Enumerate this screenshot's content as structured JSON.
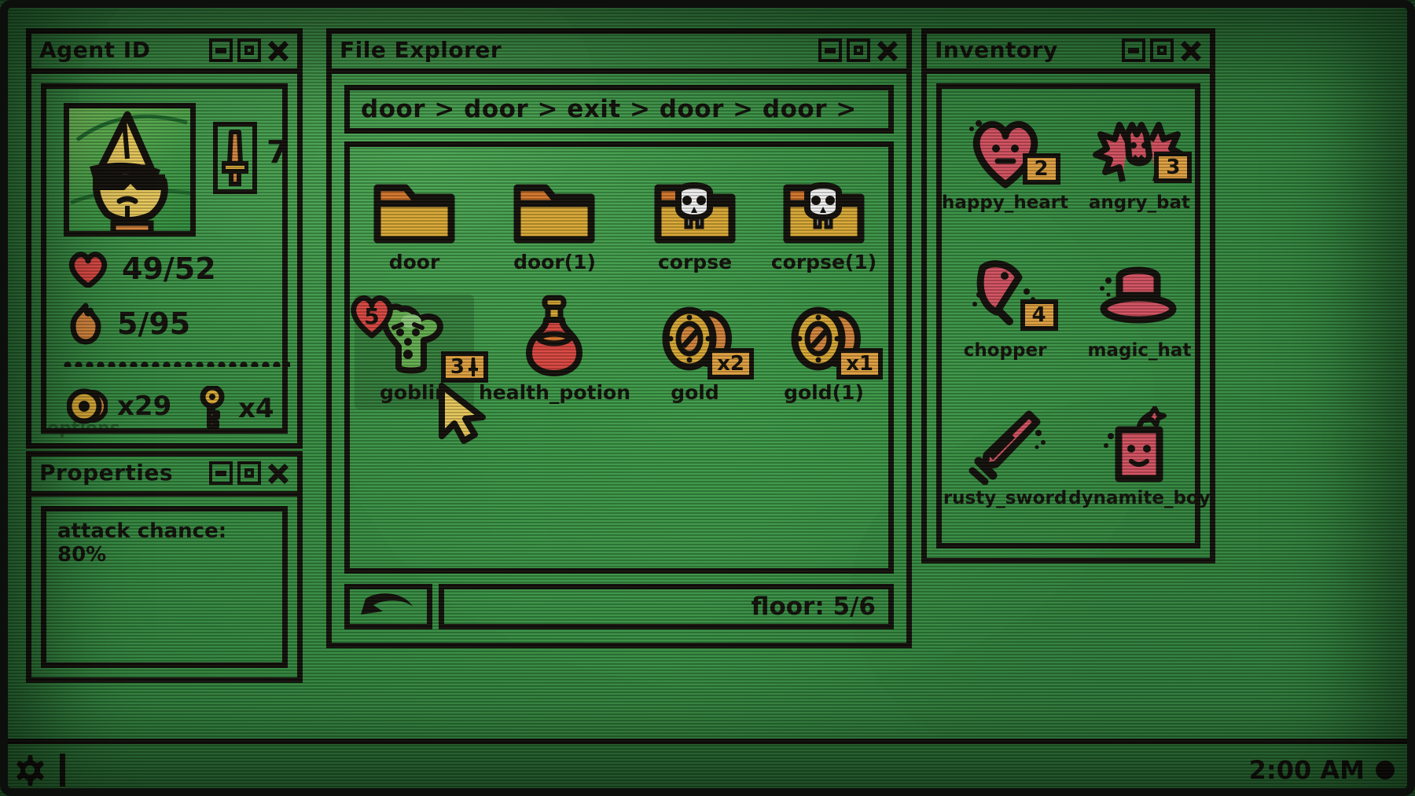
{
  "theme": {
    "screen_green": "#3d9a47",
    "ink_black": "#120f0a",
    "gold": "#d9a833",
    "orange": "#d4762a",
    "red": "#d9453f",
    "pink_red": "#d2505f",
    "goblin_green": "#63b04f",
    "bone_white": "#f2f2f2",
    "badge_orange": "#e0a03f"
  },
  "agent_id": {
    "title": "Agent ID",
    "window_buttons": [
      "minimize-button",
      "maximize-button",
      "close-button"
    ],
    "portrait_alt": "wizard-hat-sunglasses-character",
    "attack_icon": "sword-icon",
    "attack_value": "7",
    "health": {
      "icon": "heart-icon",
      "value": "49/52"
    },
    "mana": {
      "icon": "flame-icon",
      "value": "5/95"
    },
    "coins": {
      "icon": "coin-icon",
      "value": "x29"
    },
    "keys": {
      "icon": "key-icon",
      "value": "x4"
    }
  },
  "ghost_text": "options",
  "properties": {
    "title": "Properties",
    "lines": [
      "attack chance: 80%"
    ]
  },
  "file_explorer": {
    "title": "File Explorer",
    "breadcrumb": "door > door > exit > door > door >",
    "back_button_label": "back-arrow-icon",
    "floor_label": "floor: 5/6",
    "items": [
      {
        "label": "door",
        "icon": "folder-icon",
        "selected": false,
        "badges": []
      },
      {
        "label": "door(1)",
        "icon": "folder-icon",
        "selected": false,
        "badges": []
      },
      {
        "label": "corpse",
        "icon": "folder-skull-icon",
        "selected": false,
        "badges": []
      },
      {
        "label": "corpse(1)",
        "icon": "folder-skull-icon",
        "selected": false,
        "badges": []
      },
      {
        "label": "goblin",
        "icon": "goblin-icon",
        "selected": true,
        "badges": [
          {
            "type": "health",
            "value": "5"
          },
          {
            "type": "attack",
            "value": "3"
          }
        ]
      },
      {
        "label": "health_potion",
        "icon": "potion-icon",
        "selected": false,
        "badges": []
      },
      {
        "label": "gold",
        "icon": "gold-coins-icon",
        "selected": false,
        "badges": [
          {
            "type": "count",
            "value": "x2"
          }
        ]
      },
      {
        "label": "gold(1)",
        "icon": "gold-coins-icon",
        "selected": false,
        "badges": [
          {
            "type": "count",
            "value": "x1"
          }
        ]
      }
    ]
  },
  "inventory": {
    "title": "Inventory",
    "items": [
      {
        "label": "happy_heart",
        "icon": "happy-heart-icon",
        "count": "2"
      },
      {
        "label": "angry_bat",
        "icon": "angry-bat-icon",
        "count": "3"
      },
      {
        "label": "chopper",
        "icon": "chopper-icon",
        "count": "4"
      },
      {
        "label": "magic_hat",
        "icon": "magic-hat-icon",
        "count": ""
      },
      {
        "label": "rusty_sword",
        "icon": "rusty-sword-icon",
        "count": ""
      },
      {
        "label": "dynamite_boy",
        "icon": "dynamite-boy-icon",
        "count": ""
      }
    ]
  },
  "taskbar": {
    "settings_icon": "gear-icon",
    "clock": "2:00 AM",
    "power_indicator": "power-dot-icon"
  },
  "cursor": {
    "icon": "mouse-cursor-icon"
  }
}
